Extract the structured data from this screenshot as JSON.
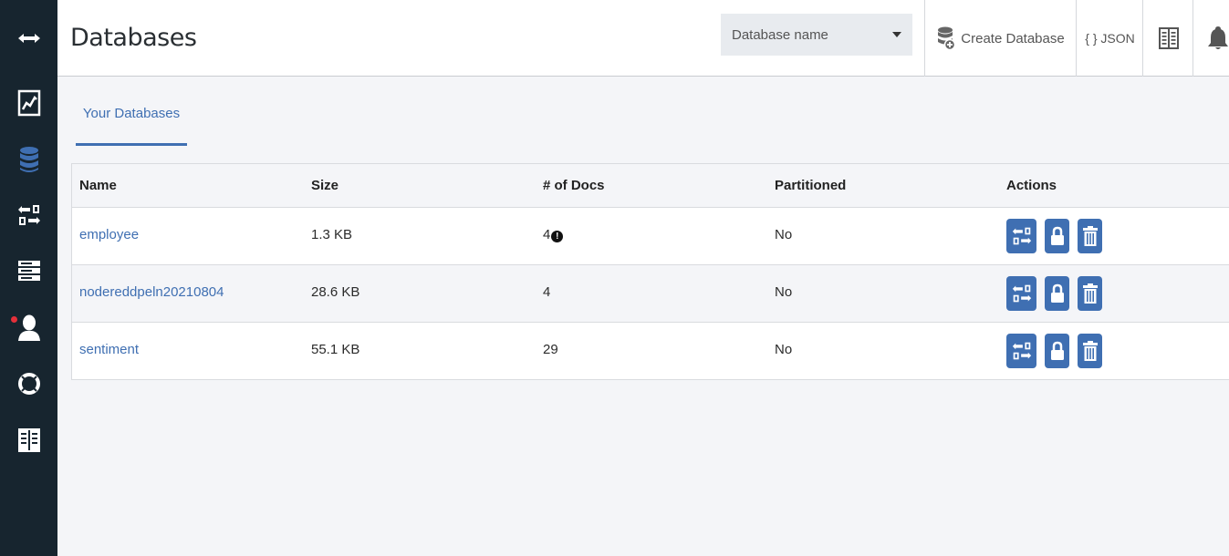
{
  "sidebar": {
    "items": [
      {
        "icon": "collapse-arrows-icon"
      },
      {
        "icon": "chart-icon"
      },
      {
        "icon": "database-icon"
      },
      {
        "icon": "replication-icon"
      },
      {
        "icon": "server-icon"
      },
      {
        "icon": "user-icon"
      },
      {
        "icon": "lifebuoy-icon"
      },
      {
        "icon": "book-icon"
      }
    ],
    "active_color": "#3f6fb2",
    "background": "#17252f"
  },
  "header": {
    "title": "Databases",
    "db_select_placeholder": "Database name",
    "create_label": "Create Database",
    "json_label": "{ } JSON"
  },
  "tabs": [
    {
      "label": "Your Databases",
      "active": true
    }
  ],
  "table": {
    "headers": [
      "Name",
      "Size",
      "# of Docs",
      "Partitioned",
      "Actions"
    ],
    "rows": [
      {
        "name": "employee",
        "size": "1.3 KB",
        "docs": "4",
        "warning": true,
        "partitioned": "No"
      },
      {
        "name": "nodereddpeln20210804",
        "size": "28.6 KB",
        "docs": "4",
        "warning": false,
        "partitioned": "No"
      },
      {
        "name": "sentiment",
        "size": "55.1 KB",
        "docs": "29",
        "warning": false,
        "partitioned": "No"
      }
    ],
    "action_icons": [
      "replicate-icon",
      "lock-icon",
      "trash-icon"
    ]
  }
}
